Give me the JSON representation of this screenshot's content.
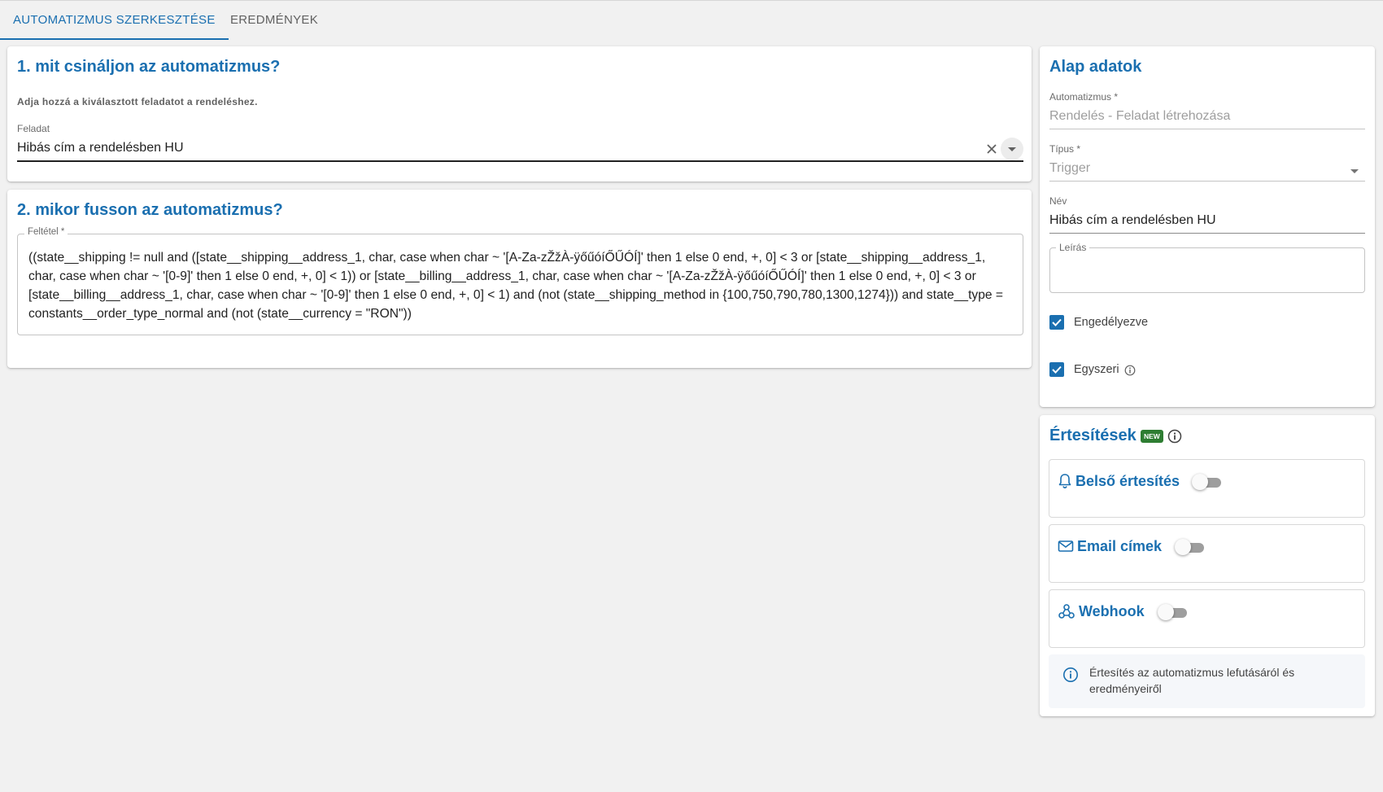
{
  "tabs": [
    {
      "label": "AUTOMATIZMUS SZERKESZTÉSE",
      "active": true
    },
    {
      "label": "EREDMÉNYEK",
      "active": false
    }
  ],
  "section1": {
    "title": "1. mit csináljon az automatizmus?",
    "description": "Adja hozzá a kiválasztott feladatot a rendeléshez.",
    "task_label": "Feladat",
    "task_value": "Hibás cím a rendelésben HU",
    "clear_icon": "close-icon",
    "dropdown_icon": "chevron-down-icon"
  },
  "section2": {
    "title": "2. mikor fusson az automatizmus?",
    "condition_label": "Feltétel *",
    "condition_value": "((state__shipping != null and ([state__shipping__address_1, char, case when char ~ '[A-Za-zŽžÀ-ÿőűóíŐŰÓÍ]' then 1 else 0 end, +, 0] < 3 or [state__shipping__address_1, char, case when char ~ '[0-9]' then 1 else 0 end, +, 0] < 1)) or [state__billing__address_1, char, case when char ~ '[A-Za-zŽžÀ-ÿőűóíŐŰÓÍ]' then 1 else 0 end, +, 0] < 3 or [state__billing__address_1, char, case when char ~ '[0-9]' then 1 else 0 end, +, 0] < 1) and (not (state__shipping_method in {100,750,790,780,1300,1274})) and state__type = constants__order_type_normal and (not (state__currency = \"RON\"))"
  },
  "basic_data": {
    "title": "Alap adatok",
    "automation_label": "Automatizmus *",
    "automation_value": "Rendelés - Feladat létrehozása",
    "type_label": "Típus *",
    "type_value": "Trigger",
    "name_label": "Név",
    "name_value": "Hibás cím a rendelésben HU",
    "description_label": "Leírás",
    "description_value": "",
    "enabled_label": "Engedélyezve",
    "enabled_checked": true,
    "onetime_label": "Egyszeri",
    "onetime_checked": true
  },
  "notifications": {
    "title": "Értesítések",
    "new_badge": "NEW",
    "items": [
      {
        "label": "Belső értesítés",
        "icon": "bell-icon",
        "enabled": false
      },
      {
        "label": "Email címek",
        "icon": "envelope-icon",
        "enabled": false
      },
      {
        "label": "Webhook",
        "icon": "webhook-icon",
        "enabled": false
      }
    ],
    "info_text": "Értesítés az automatizmus lefutásáról és eredményeiről"
  },
  "colors": {
    "accent": "#1a6fb0",
    "background": "#f1f1f1",
    "badge_green": "#2e7d32"
  }
}
